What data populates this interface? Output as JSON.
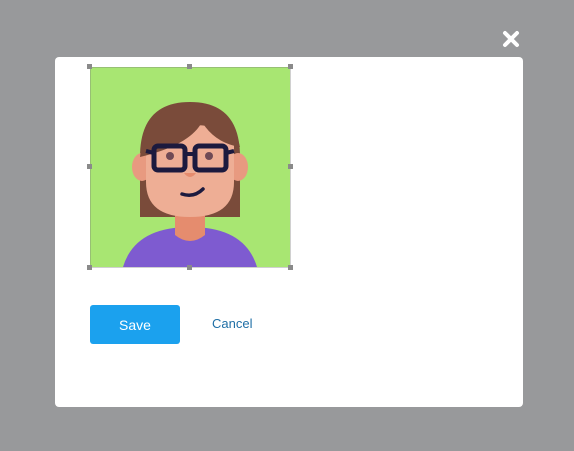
{
  "dialog": {
    "close_icon": "close-icon",
    "save_label": "Save",
    "cancel_label": "Cancel",
    "avatar_icon": "avatar-illustration"
  },
  "colors": {
    "overlay": "#98999b",
    "modal_bg": "#ffffff",
    "primary_button": "#1ba1ee",
    "link": "#1f6fa6",
    "avatar_bg": "#a8e672"
  }
}
